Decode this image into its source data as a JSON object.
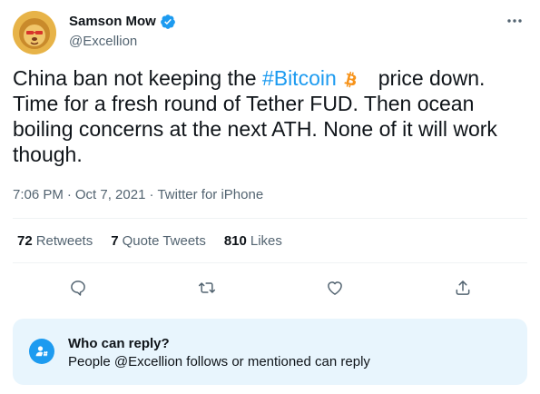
{
  "author": {
    "display_name": "Samson Mow",
    "handle": "@Excellion",
    "verified": true
  },
  "tweet": {
    "text_before": "China ban not keeping the ",
    "hashtag": "#Bitcoin",
    "text_after": "price down. Time for a fresh round of Tether FUD. Then ocean boiling concerns at the next ATH. None of it will work though.",
    "time": "7:06 PM",
    "separator_1": "·",
    "date": "Oct 7, 2021",
    "separator_2": "·",
    "source": "Twitter for iPhone"
  },
  "stats": {
    "retweets_count": "72",
    "retweets_label": "Retweets",
    "quotes_count": "7",
    "quotes_label": "Quote Tweets",
    "likes_count": "810",
    "likes_label": "Likes"
  },
  "reply_settings": {
    "title": "Who can reply?",
    "subtitle": "People @Excellion follows or mentioned can reply"
  },
  "colors": {
    "accent": "#1d9bf0",
    "bitcoin": "#f7931a",
    "text_primary": "#0f1419",
    "text_secondary": "#536471",
    "reply_bg": "#e8f5fd"
  },
  "icons": {
    "verified": "verified-badge-icon",
    "more": "more-options-icon",
    "bitcoin": "bitcoin-icon",
    "reply": "reply-icon",
    "retweet": "retweet-icon",
    "like": "like-icon",
    "share": "share-icon",
    "who_can_reply": "mention-icon"
  }
}
